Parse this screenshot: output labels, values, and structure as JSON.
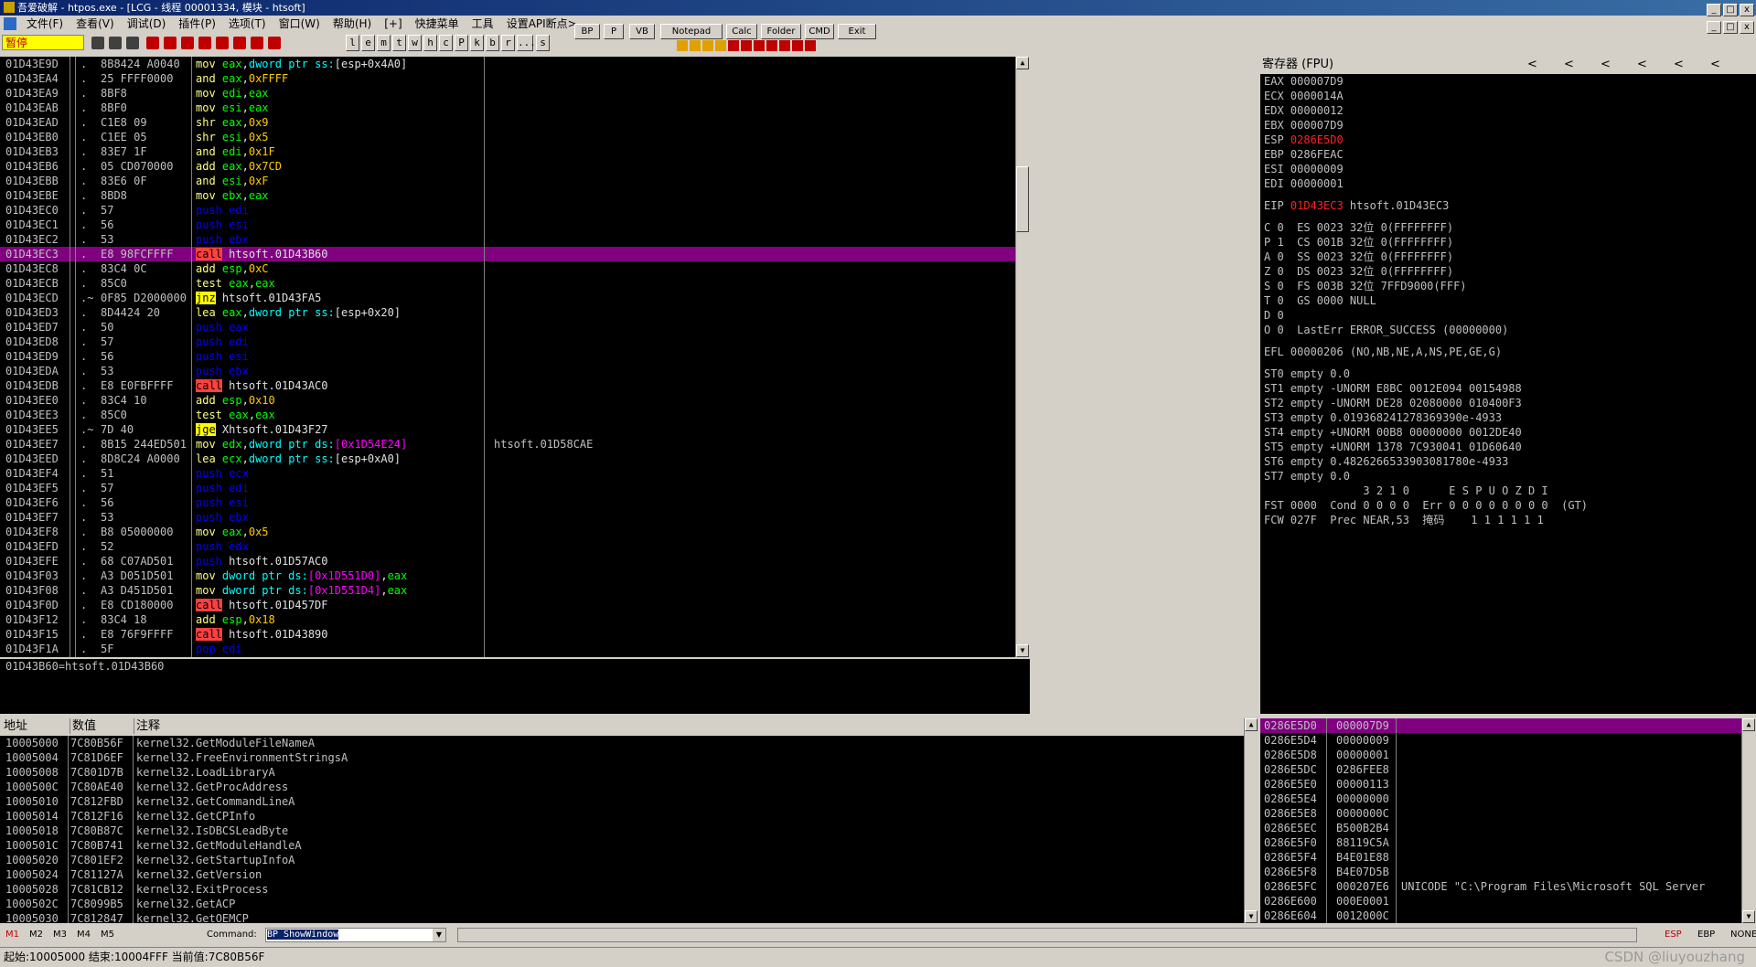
{
  "title": "吾爱破解 - htpos.exe - [LCG - 线程 00001334, 模块 - htsoft]",
  "menu": [
    "文件(F)",
    "查看(V)",
    "调试(D)",
    "插件(P)",
    "选项(T)",
    "窗口(W)",
    "帮助(H)",
    "[+]",
    "快捷菜单",
    "工具",
    "设置API断点>"
  ],
  "toolbar": {
    "state": "暂停",
    "letters": [
      "l",
      "e",
      "m",
      "t",
      "w",
      "h",
      "c",
      "P",
      "k",
      "b",
      "r",
      "...",
      "s"
    ],
    "quick": [
      "BP",
      "P",
      "VB",
      "Notepad",
      "Calc",
      "Folder",
      "CMD",
      "Exit"
    ]
  },
  "cpu": [
    {
      "a": "01D43E9D",
      "d": ".",
      "h": "8B8424 A0040",
      "o": "mov",
      "args": [
        [
          "reg",
          "eax"
        ],
        [
          "w",
          ","
        ],
        [
          "kw",
          "dword ptr ss:"
        ],
        [
          "w",
          "[esp+0x4A0]"
        ]
      ]
    },
    {
      "a": "01D43EA4",
      "d": ".",
      "h": "25 FFFF0000",
      "o": "and",
      "args": [
        [
          "reg",
          "eax"
        ],
        [
          "w",
          ","
        ],
        [
          "imm",
          "0xFFFF"
        ]
      ]
    },
    {
      "a": "01D43EA9",
      "d": ".",
      "h": "8BF8",
      "o": "mov",
      "args": [
        [
          "reg",
          "edi"
        ],
        [
          "w",
          ","
        ],
        [
          "reg",
          "eax"
        ]
      ]
    },
    {
      "a": "01D43EAB",
      "d": ".",
      "h": "8BF0",
      "o": "mov",
      "args": [
        [
          "reg",
          "esi"
        ],
        [
          "w",
          ","
        ],
        [
          "reg",
          "eax"
        ]
      ]
    },
    {
      "a": "01D43EAD",
      "d": ".",
      "h": "C1E8 09",
      "o": "shr",
      "args": [
        [
          "reg",
          "eax"
        ],
        [
          "w",
          ","
        ],
        [
          "imm",
          "0x9"
        ]
      ]
    },
    {
      "a": "01D43EB0",
      "d": ".",
      "h": "C1EE 05",
      "o": "shr",
      "args": [
        [
          "reg",
          "esi"
        ],
        [
          "w",
          ","
        ],
        [
          "imm",
          "0x5"
        ]
      ]
    },
    {
      "a": "01D43EB3",
      "d": ".",
      "h": "83E7 1F",
      "o": "and",
      "args": [
        [
          "reg",
          "edi"
        ],
        [
          "w",
          ","
        ],
        [
          "imm",
          "0x1F"
        ]
      ]
    },
    {
      "a": "01D43EB6",
      "d": ".",
      "h": "05 CD070000",
      "o": "add",
      "args": [
        [
          "reg",
          "eax"
        ],
        [
          "w",
          ","
        ],
        [
          "imm",
          "0x7CD"
        ]
      ]
    },
    {
      "a": "01D43EBB",
      "d": ".",
      "h": "83E6 0F",
      "o": "and",
      "args": [
        [
          "reg",
          "esi"
        ],
        [
          "w",
          ","
        ],
        [
          "imm",
          "0xF"
        ]
      ]
    },
    {
      "a": "01D43EBE",
      "d": ".",
      "h": "8BD8",
      "o": "mov",
      "args": [
        [
          "reg",
          "ebx"
        ],
        [
          "w",
          ","
        ],
        [
          "reg",
          "eax"
        ]
      ]
    },
    {
      "a": "01D43EC0",
      "d": ".",
      "h": "57",
      "o": "push",
      "args": [
        [
          "reg",
          "edi"
        ]
      ]
    },
    {
      "a": "01D43EC1",
      "d": ".",
      "h": "56",
      "o": "push",
      "args": [
        [
          "reg",
          "esi"
        ]
      ]
    },
    {
      "a": "01D43EC2",
      "d": ".",
      "h": "53",
      "o": "push",
      "args": [
        [
          "reg",
          "ebx"
        ]
      ]
    },
    {
      "a": "01D43EC3",
      "d": ".",
      "h": "E8 98FCFFFF",
      "o": "call",
      "args": [
        [
          "w",
          "htsoft.01D43B60"
        ]
      ],
      "sel": true
    },
    {
      "a": "01D43EC8",
      "d": ".",
      "h": "83C4 0C",
      "o": "add",
      "args": [
        [
          "reg",
          "esp"
        ],
        [
          "w",
          ","
        ],
        [
          "imm",
          "0xC"
        ]
      ]
    },
    {
      "a": "01D43ECB",
      "d": ".",
      "h": "85C0",
      "o": "test",
      "args": [
        [
          "reg",
          "eax"
        ],
        [
          "w",
          ","
        ],
        [
          "reg",
          "eax"
        ]
      ]
    },
    {
      "a": "01D43ECD",
      "d": ".~",
      "h": "0F85 D2000000",
      "o": "jnz",
      "args": [
        [
          "w",
          "htsoft.01D43FA5"
        ]
      ]
    },
    {
      "a": "01D43ED3",
      "d": ".",
      "h": "8D4424 20",
      "o": "lea",
      "args": [
        [
          "reg",
          "eax"
        ],
        [
          "w",
          ","
        ],
        [
          "kw",
          "dword ptr ss:"
        ],
        [
          "w",
          "[esp+0x20]"
        ]
      ]
    },
    {
      "a": "01D43ED7",
      "d": ".",
      "h": "50",
      "o": "push",
      "args": [
        [
          "reg",
          "eax"
        ]
      ]
    },
    {
      "a": "01D43ED8",
      "d": ".",
      "h": "57",
      "o": "push",
      "args": [
        [
          "reg",
          "edi"
        ]
      ]
    },
    {
      "a": "01D43ED9",
      "d": ".",
      "h": "56",
      "o": "push",
      "args": [
        [
          "reg",
          "esi"
        ]
      ]
    },
    {
      "a": "01D43EDA",
      "d": ".",
      "h": "53",
      "o": "push",
      "args": [
        [
          "reg",
          "ebx"
        ]
      ]
    },
    {
      "a": "01D43EDB",
      "d": ".",
      "h": "E8 E0FBFFFF",
      "o": "call",
      "args": [
        [
          "w",
          "htsoft.01D43AC0"
        ]
      ]
    },
    {
      "a": "01D43EE0",
      "d": ".",
      "h": "83C4 10",
      "o": "add",
      "args": [
        [
          "reg",
          "esp"
        ],
        [
          "w",
          ","
        ],
        [
          "imm",
          "0x10"
        ]
      ]
    },
    {
      "a": "01D43EE3",
      "d": ".",
      "h": "85C0",
      "o": "test",
      "args": [
        [
          "reg",
          "eax"
        ],
        [
          "w",
          ","
        ],
        [
          "reg",
          "eax"
        ]
      ]
    },
    {
      "a": "01D43EE5",
      "d": ".~",
      "h": "7D 40",
      "o": "jge",
      "args": [
        [
          "w",
          "Xhtsoft.01D43F27"
        ]
      ]
    },
    {
      "a": "01D43EE7",
      "d": ".",
      "h": "8B15 244ED501",
      "o": "mov",
      "args": [
        [
          "reg",
          "edx"
        ],
        [
          "w",
          ","
        ],
        [
          "kw",
          "dword ptr ds:"
        ],
        [
          "mem",
          "[0x1D54E24]"
        ]
      ],
      "c": "htsoft.01D58CAE"
    },
    {
      "a": "01D43EED",
      "d": ".",
      "h": "8D8C24 A0000",
      "o": "lea",
      "args": [
        [
          "reg",
          "ecx"
        ],
        [
          "w",
          ","
        ],
        [
          "kw",
          "dword ptr ss:"
        ],
        [
          "w",
          "[esp+0xA0]"
        ]
      ]
    },
    {
      "a": "01D43EF4",
      "d": ".",
      "h": "51",
      "o": "push",
      "args": [
        [
          "reg",
          "ecx"
        ]
      ]
    },
    {
      "a": "01D43EF5",
      "d": ".",
      "h": "57",
      "o": "push",
      "args": [
        [
          "reg",
          "edi"
        ]
      ]
    },
    {
      "a": "01D43EF6",
      "d": ".",
      "h": "56",
      "o": "push",
      "args": [
        [
          "reg",
          "esi"
        ]
      ]
    },
    {
      "a": "01D43EF7",
      "d": ".",
      "h": "53",
      "o": "push",
      "args": [
        [
          "reg",
          "ebx"
        ]
      ]
    },
    {
      "a": "01D43EF8",
      "d": ".",
      "h": "B8 05000000",
      "o": "mov",
      "args": [
        [
          "reg",
          "eax"
        ],
        [
          "w",
          ","
        ],
        [
          "imm",
          "0x5"
        ]
      ]
    },
    {
      "a": "01D43EFD",
      "d": ".",
      "h": "52",
      "o": "push",
      "args": [
        [
          "reg",
          "edx"
        ]
      ]
    },
    {
      "a": "01D43EFE",
      "d": ".",
      "h": "68 C07AD501",
      "o": "push",
      "args": [
        [
          "w",
          "htsoft.01D57AC0"
        ]
      ]
    },
    {
      "a": "01D43F03",
      "d": ".",
      "h": "A3 D051D501",
      "o": "mov",
      "args": [
        [
          "kw",
          "dword ptr ds:"
        ],
        [
          "mem",
          "[0x1D551D0]"
        ],
        [
          "w",
          ","
        ],
        [
          "reg",
          "eax"
        ]
      ]
    },
    {
      "a": "01D43F08",
      "d": ".",
      "h": "A3 D451D501",
      "o": "mov",
      "args": [
        [
          "kw",
          "dword ptr ds:"
        ],
        [
          "mem",
          "[0x1D551D4]"
        ],
        [
          "w",
          ","
        ],
        [
          "reg",
          "eax"
        ]
      ]
    },
    {
      "a": "01D43F0D",
      "d": ".",
      "h": "E8 CD180000",
      "o": "call",
      "args": [
        [
          "w",
          "htsoft.01D457DF"
        ]
      ]
    },
    {
      "a": "01D43F12",
      "d": ".",
      "h": "83C4 18",
      "o": "add",
      "args": [
        [
          "reg",
          "esp"
        ],
        [
          "w",
          ","
        ],
        [
          "imm",
          "0x18"
        ]
      ]
    },
    {
      "a": "01D43F15",
      "d": ".",
      "h": "E8 76F9FFFF",
      "o": "call",
      "args": [
        [
          "w",
          "htsoft.01D43890"
        ]
      ]
    },
    {
      "a": "01D43F1A",
      "d": ".",
      "h": "5F",
      "o": "pop",
      "args": [
        [
          "reg",
          "edi"
        ]
      ]
    }
  ],
  "info_line": "01D43B60=htsoft.01D43B60",
  "registers": {
    "title": "寄存器 (FPU)",
    "arrows": [
      "<",
      "<",
      "<",
      "<",
      "<",
      "<"
    ],
    "lines": [
      [
        [
          "n",
          "EAX "
        ],
        [
          "v",
          "000007D9"
        ]
      ],
      [
        [
          "n",
          "ECX "
        ],
        [
          "v",
          "0000014A"
        ]
      ],
      [
        [
          "n",
          "EDX "
        ],
        [
          "v",
          "00000012"
        ]
      ],
      [
        [
          "n",
          "EBX "
        ],
        [
          "v",
          "000007D9"
        ]
      ],
      [
        [
          "n",
          "ESP "
        ],
        [
          "r",
          "0286E5D0"
        ]
      ],
      [
        [
          "n",
          "EBP "
        ],
        [
          "v",
          "0286FEAC"
        ]
      ],
      [
        [
          "n",
          "ESI "
        ],
        [
          "v",
          "00000009"
        ]
      ],
      [
        [
          "n",
          "EDI "
        ],
        [
          "v",
          "00000001"
        ]
      ],
      [],
      [
        [
          "n",
          "EIP "
        ],
        [
          "r",
          "01D43EC3"
        ],
        [
          "v",
          " htsoft.01D43EC3"
        ]
      ],
      [],
      [
        [
          "v",
          "C 0  ES 0023 32位 0(FFFFFFFF)"
        ]
      ],
      [
        [
          "v",
          "P 1  CS 001B 32位 0(FFFFFFFF)"
        ]
      ],
      [
        [
          "v",
          "A 0  SS 0023 32位 0(FFFFFFFF)"
        ]
      ],
      [
        [
          "v",
          "Z 0  DS 0023 32位 0(FFFFFFFF)"
        ]
      ],
      [
        [
          "v",
          "S 0  FS 003B 32位 7FFD9000(FFF)"
        ]
      ],
      [
        [
          "v",
          "T 0  GS 0000 NULL"
        ]
      ],
      [
        [
          "v",
          "D 0"
        ]
      ],
      [
        [
          "v",
          "O 0  LastErr ERROR_SUCCESS (00000000)"
        ]
      ],
      [],
      [
        [
          "v",
          "EFL 00000206 (NO,NB,NE,A,NS,PE,GE,G)"
        ]
      ],
      [],
      [
        [
          "v",
          "ST0 empty 0.0"
        ]
      ],
      [
        [
          "v",
          "ST1 empty -UNORM E8BC 0012E094 00154988"
        ]
      ],
      [
        [
          "v",
          "ST2 empty -UNORM DE28 02080000 010400F3"
        ]
      ],
      [
        [
          "v",
          "ST3 empty 0.01936824127836939​0e-4933"
        ]
      ],
      [
        [
          "v",
          "ST4 empty +UNORM 00B8 00000000 0012DE40"
        ]
      ],
      [
        [
          "v",
          "ST5 empty +UNORM 1378 7C930041 01D60640"
        ]
      ],
      [
        [
          "v",
          "ST6 empty 0.4826266533903081780e-4933"
        ]
      ],
      [
        [
          "v",
          "ST7 empty 0.0"
        ]
      ],
      [
        [
          "v",
          "               3 2 1 0      E S P U O Z D I"
        ]
      ],
      [
        [
          "v",
          "FST 0000  Cond 0 0 0 0  Err 0 0 0 0 0 0 0 0  (GT)"
        ]
      ],
      [
        [
          "v",
          "FCW 027F  Prec NEAR,53  掩码    1 1 1 1 1 1"
        ]
      ]
    ]
  },
  "dump": {
    "headers": [
      "地址",
      "数值",
      "注释"
    ],
    "rows": [
      [
        "10005000",
        "7C80B56F",
        "kernel32.GetModuleFileNameA"
      ],
      [
        "10005004",
        "7C81D6EF",
        "kernel32.FreeEnvironmentStringsA"
      ],
      [
        "10005008",
        "7C801D7B",
        "kernel32.LoadLibraryA"
      ],
      [
        "1000500C",
        "7C80AE40",
        "kernel32.GetProcAddress"
      ],
      [
        "10005010",
        "7C812FBD",
        "kernel32.GetCommandLineA"
      ],
      [
        "10005014",
        "7C812F16",
        "kernel32.GetCPInfo"
      ],
      [
        "10005018",
        "7C80B87C",
        "kernel32.IsDBCSLeadByte"
      ],
      [
        "1000501C",
        "7C80B741",
        "kernel32.GetModuleHandleA"
      ],
      [
        "10005020",
        "7C801EF2",
        "kernel32.GetStartupInfoA"
      ],
      [
        "10005024",
        "7C81127A",
        "kernel32.GetVersion"
      ],
      [
        "10005028",
        "7C81CB12",
        "kernel32.ExitProcess"
      ],
      [
        "1000502C",
        "7C8099B5",
        "kernel32.GetACP"
      ],
      [
        "10005030",
        "7C812847",
        "kernel32.GetOEMCP"
      ]
    ]
  },
  "stack": [
    [
      "0286E5D0",
      "000007D9",
      ""
    ],
    [
      "0286E5D4",
      "00000009",
      ""
    ],
    [
      "0286E5D8",
      "00000001",
      ""
    ],
    [
      "0286E5DC",
      "0286FEE8",
      ""
    ],
    [
      "0286E5E0",
      "00000113",
      ""
    ],
    [
      "0286E5E4",
      "00000000",
      ""
    ],
    [
      "0286E5E8",
      "0000000C",
      ""
    ],
    [
      "0286E5EC",
      "B500B2B4",
      ""
    ],
    [
      "0286E5F0",
      "88119C5A",
      ""
    ],
    [
      "0286E5F4",
      "B4E01E88",
      ""
    ],
    [
      "0286E5F8",
      "B4E07D5B",
      ""
    ],
    [
      "0286E5FC",
      "000207E6",
      "UNICODE \"C:\\Program Files\\Microsoft SQL Server"
    ],
    [
      "0286E600",
      "000E0001",
      ""
    ],
    [
      "0286E604",
      "0012000C",
      ""
    ]
  ],
  "cmdbar": {
    "mtabs": [
      "M1",
      "M2",
      "M3",
      "M4",
      "M5"
    ],
    "label": "Command:",
    "value": "BP ShowWindow",
    "regs": [
      "ESP",
      "EBP",
      "NONE"
    ]
  },
  "status": "起始:10005000 结束:10004FFF 当前值:7C80B56F",
  "watermark": "CSDN @liuyouzhang",
  "colors": {
    "reg": "#00ff00",
    "imm": "#ffcc00",
    "kw": "#00ffff",
    "mem": "#ff00ff",
    "push": "#0000ff",
    "call": "#ff4040",
    "jmp": "#ffff00",
    "sel": "#800080"
  }
}
